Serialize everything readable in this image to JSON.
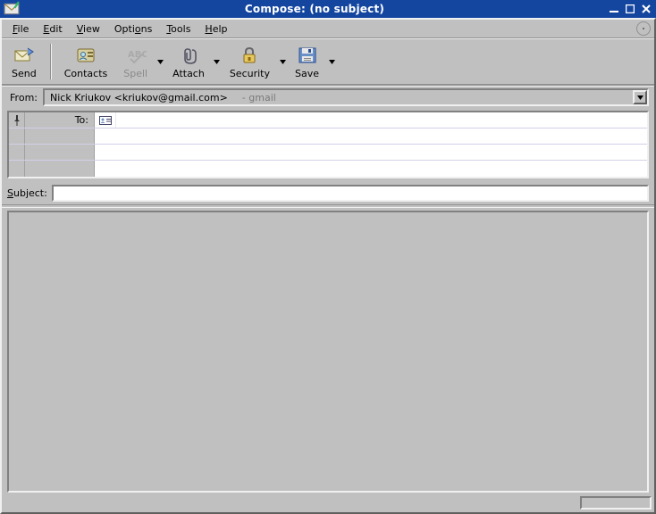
{
  "window": {
    "title": "Compose: (no subject)"
  },
  "menu": {
    "file": "File",
    "edit": "Edit",
    "view": "View",
    "options": "Options",
    "tools": "Tools",
    "help": "Help"
  },
  "toolbar": {
    "send": "Send",
    "contacts": "Contacts",
    "spell": "Spell",
    "attach": "Attach",
    "security": "Security",
    "save": "Save"
  },
  "from": {
    "label": "From:",
    "value": "Nick Kriukov <kriukov@gmail.com>",
    "account_hint": "- gmail"
  },
  "recipients": {
    "rows": [
      {
        "type": "To:",
        "value": ""
      },
      {
        "type": "",
        "value": ""
      },
      {
        "type": "",
        "value": ""
      },
      {
        "type": "",
        "value": ""
      }
    ]
  },
  "subject": {
    "label": "Subject:",
    "value": ""
  },
  "body": {
    "value": ""
  },
  "colors": {
    "accent": "#1446a0"
  }
}
